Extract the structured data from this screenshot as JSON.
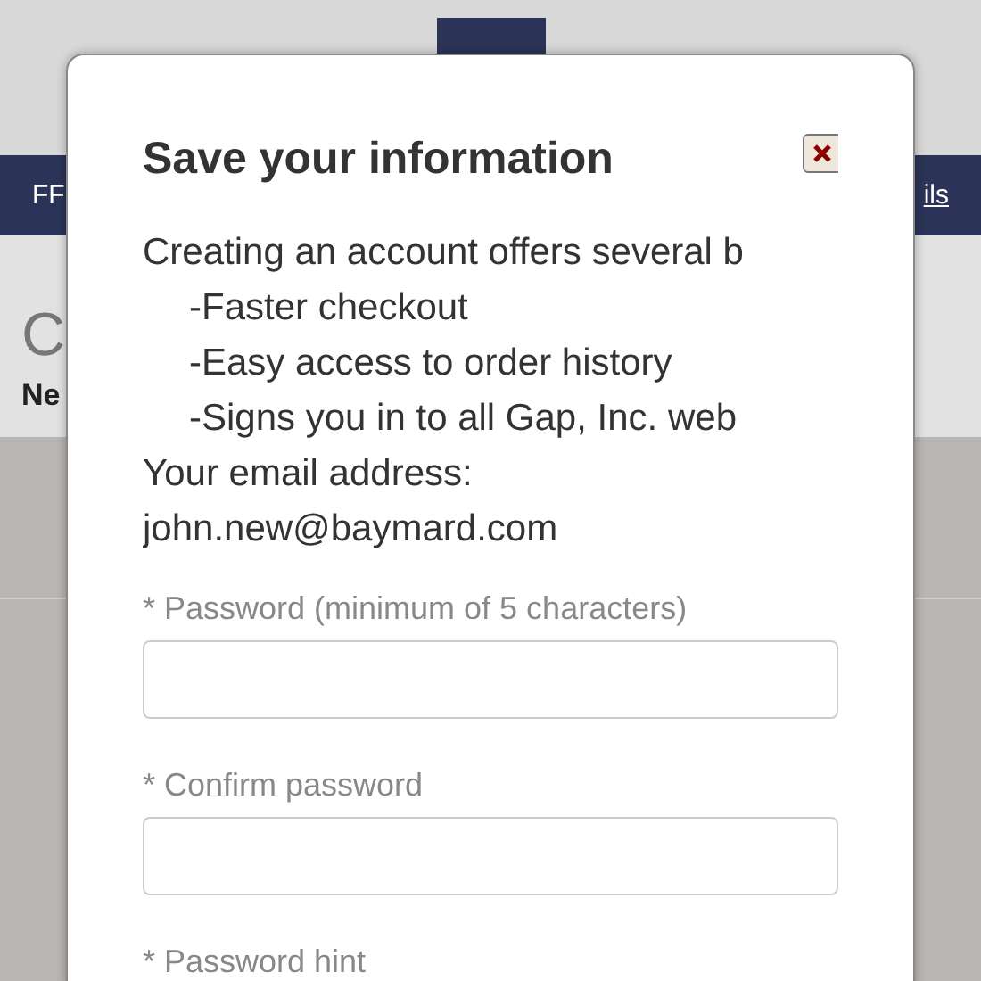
{
  "page": {
    "nav_left": "FF",
    "nav_right": "ils",
    "heading": "C",
    "subheading": "Ne"
  },
  "dialog": {
    "title": "Save your information",
    "intro": "Creating an account offers several b",
    "benefits": [
      "-Faster checkout",
      "-Easy access to order history",
      "-Signs you in to all Gap, Inc. web"
    ],
    "email_label": "Your email address:",
    "email": "john.new@baymard.com",
    "fields": [
      {
        "kind": "input",
        "label": "* Password (minimum of 5 characters)"
      },
      {
        "kind": "input",
        "label": "* Confirm password"
      },
      {
        "kind": "label",
        "label": "* Password hint"
      }
    ]
  }
}
